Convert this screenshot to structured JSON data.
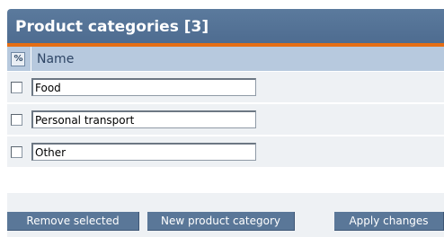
{
  "panel": {
    "title": "Product categories [3]"
  },
  "table": {
    "toggle_all_glyph": "%",
    "column_name": "Name",
    "rows": [
      {
        "name": "Food",
        "checked": false
      },
      {
        "name": "Personal transport",
        "checked": false
      },
      {
        "name": "Other",
        "checked": false
      }
    ]
  },
  "footer": {
    "remove_selected": "Remove selected",
    "new_category": "New product category",
    "apply_changes": "Apply changes"
  },
  "colors": {
    "title_bar": "#4e6c90",
    "accent": "#e56e14",
    "header_row": "#b7c9de",
    "button": "#5a7798"
  }
}
